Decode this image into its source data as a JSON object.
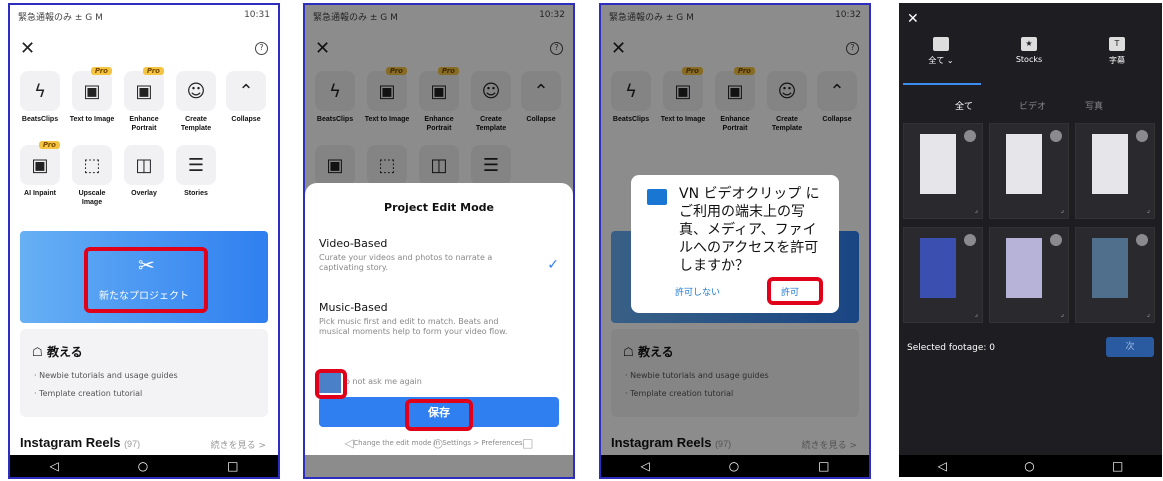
{
  "status": {
    "left": "緊急通報のみ ± G M",
    "time1": "10:31",
    "time2": "10:32"
  },
  "tools": [
    {
      "label": "BeatsClips",
      "icon": "lightning-icon",
      "pro": false
    },
    {
      "label": "Text to Image",
      "icon": "ai-image-icon",
      "pro": true
    },
    {
      "label": "Enhance Portrait",
      "icon": "hd-icon",
      "pro": true
    },
    {
      "label": "Create Template",
      "icon": "template-icon",
      "pro": false
    },
    {
      "label": "Collapse",
      "icon": "chevron-up-icon",
      "pro": false
    },
    {
      "label": "AI Inpaint",
      "icon": "inpaint-icon",
      "pro": true
    },
    {
      "label": "Upscale Image",
      "icon": "upscale-icon",
      "pro": false
    },
    {
      "label": "Overlay",
      "icon": "overlay-icon",
      "pro": false
    },
    {
      "label": "Stories",
      "icon": "stories-icon",
      "pro": false
    }
  ],
  "pro_badge": "Pro",
  "new_project": "新たなプロジェクト",
  "learn": {
    "title": "教える",
    "items": [
      "Newbie tutorials and usage guides",
      "Template creation tutorial"
    ]
  },
  "reels": {
    "title": "Instagram Reels",
    "count": "(97)",
    "more": "続きを見る >"
  },
  "mode_sheet": {
    "title": "Project Edit Mode",
    "video_title": "Video-Based",
    "video_desc": "Curate your videos and photos to narrate a captivating story.",
    "music_title": "Music-Based",
    "music_desc": "Pick music first and edit to match. Beats and musical moments help to form your video flow.",
    "dont_ask": "o not ask me again",
    "save": "保存",
    "hint": "Change the edit mode in Settings > Preferences."
  },
  "permission": {
    "text": "VN ビデオクリップ にご利用の端末上の写真、メディア、ファイルへのアクセスを許可しますか？",
    "deny": "許可しない",
    "allow": "許可"
  },
  "picker": {
    "tabs": [
      "全て ⌄",
      "Stocks",
      "字幕"
    ],
    "subtabs": [
      "全て",
      "ビデオ",
      "写真"
    ],
    "selected": "Selected footage: 0",
    "next": "次"
  },
  "colors": {
    "accent": "#2f7ff0",
    "highlight": "#e0001a",
    "frame": "#2d2dbf"
  }
}
